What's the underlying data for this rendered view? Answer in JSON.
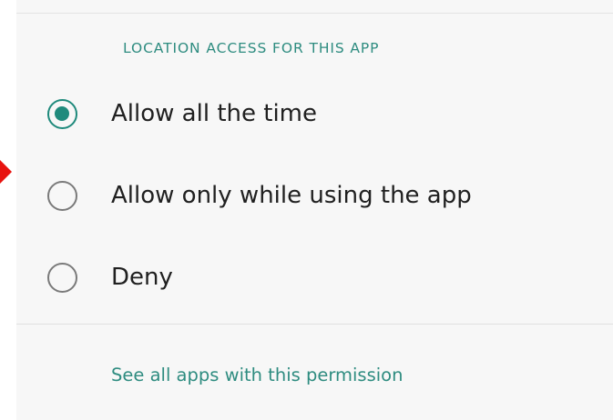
{
  "section": {
    "header": "LOCATION ACCESS FOR THIS APP"
  },
  "options": [
    {
      "label": "Allow all the time",
      "selected": true
    },
    {
      "label": "Allow only while using the app",
      "selected": false
    },
    {
      "label": "Deny",
      "selected": false
    }
  ],
  "footer": {
    "link": "See all apps with this permission"
  },
  "icons": {
    "radio_selected": "radio-checked-icon",
    "radio_unselected": "radio-unchecked-icon",
    "annotation": "red-arrow-icon"
  },
  "colors": {
    "accent": "#1f8a7c",
    "text_primary": "#202020",
    "radio_unselected": "#7a7a7a",
    "background": "#f7f7f7",
    "annotation_arrow": "#e8130f"
  }
}
